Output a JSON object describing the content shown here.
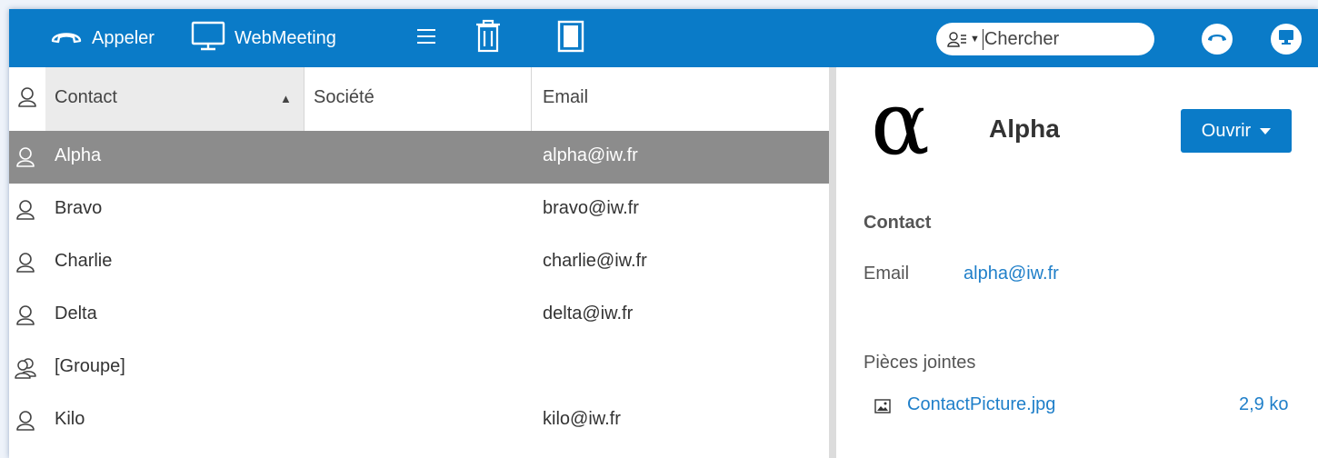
{
  "toolbar": {
    "call_label": "Appeler",
    "webmeeting_label": "WebMeeting",
    "search_placeholder": "Chercher"
  },
  "colors": {
    "accent": "#0a7bc8",
    "selected_row": "#8c8c8c",
    "link": "#1f7fc9"
  },
  "icons": [
    "phone-icon",
    "monitor-icon",
    "menu-icon",
    "trash-icon",
    "panel-icon",
    "contact-filter-icon",
    "hangup-icon",
    "screen-share-icon",
    "person-icon",
    "group-icon",
    "image-file-icon"
  ],
  "table": {
    "columns": [
      "Contact",
      "Société",
      "Email"
    ],
    "sort": "▲",
    "rows": [
      {
        "name": "Alpha",
        "company": "",
        "email": "alpha@iw.fr",
        "type": "person",
        "selected": true
      },
      {
        "name": "Bravo",
        "company": "",
        "email": "bravo@iw.fr",
        "type": "person"
      },
      {
        "name": "Charlie",
        "company": "",
        "email": "charlie@iw.fr",
        "type": "person"
      },
      {
        "name": "Delta",
        "company": "",
        "email": "delta@iw.fr",
        "type": "person"
      },
      {
        "name": "[Groupe]",
        "company": "",
        "email": "",
        "type": "group"
      },
      {
        "name": "Kilo",
        "company": "",
        "email": "kilo@iw.fr",
        "type": "person"
      }
    ]
  },
  "detail": {
    "avatar_glyph": "α",
    "name": "Alpha",
    "open_label": "Ouvrir",
    "section": "Contact",
    "email_label": "Email",
    "email_value": "alpha@iw.fr",
    "attachments_title": "Pièces jointes",
    "attachment_name": "ContactPicture.jpg",
    "attachment_size": "2,9 ko"
  }
}
